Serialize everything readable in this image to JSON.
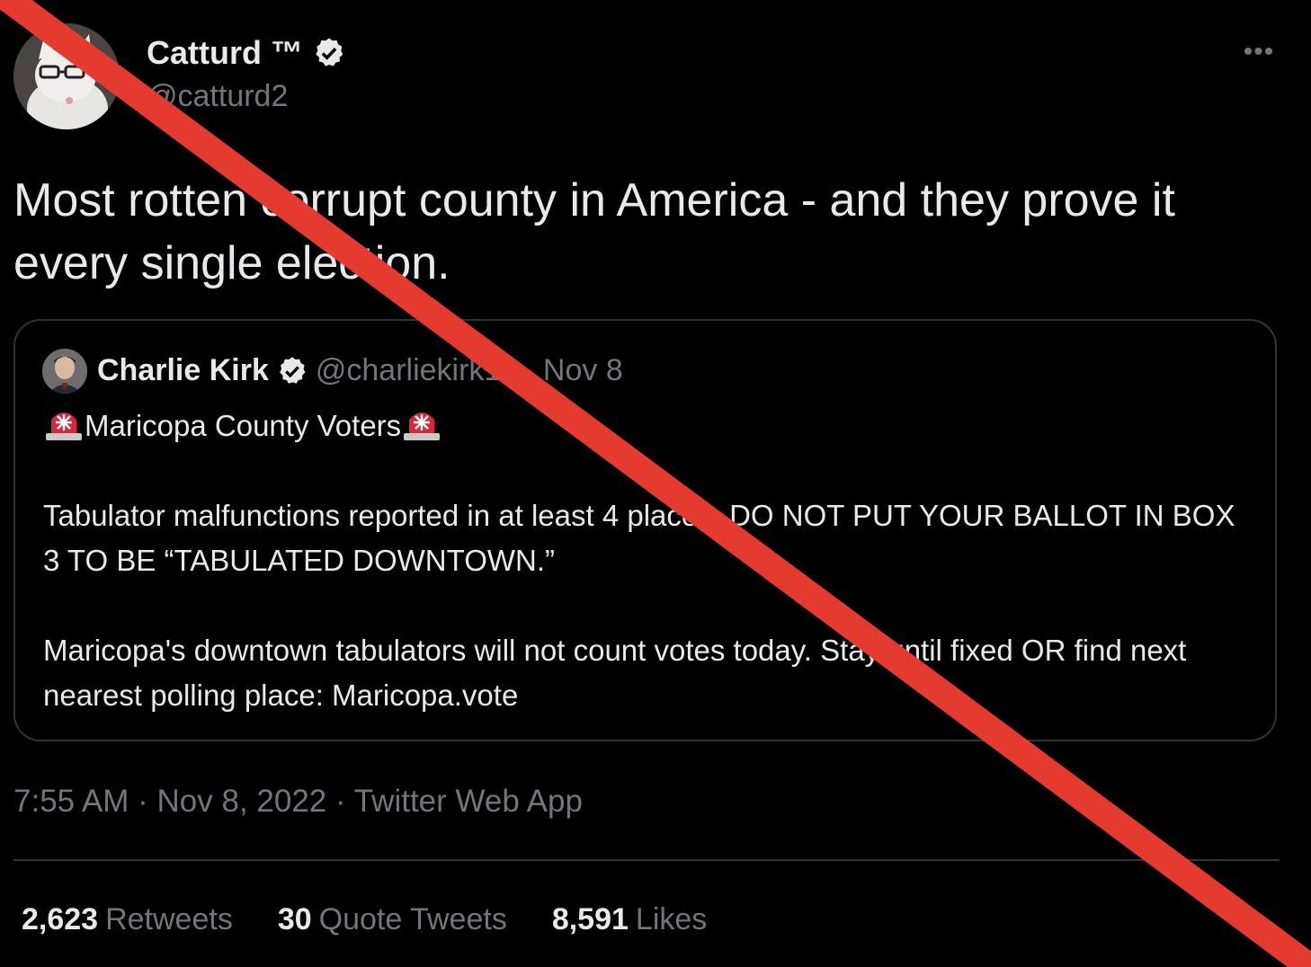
{
  "author": {
    "display_name": "Catturd ™",
    "handle": "@catturd2",
    "verified_icon": "verified-badge-icon"
  },
  "more_icon": "more-horizontal-icon",
  "tweet_text": "Most rotten corrupt county in America - and they prove it every single election.",
  "quoted_tweet": {
    "name": "Charlie Kirk",
    "handle_date": "@charliekirk11 · Nov 8",
    "heading": "Maricopa County Voters",
    "heading_icon": "police-siren-icon",
    "paragraph1": "Tabulator malfunctions reported in at least 4 places. DO NOT PUT YOUR BALLOT IN BOX 3 TO BE “TABULATED DOWNTOWN.”",
    "paragraph2": "Maricopa's downtown tabulators will not count votes today. Stay until fixed OR find next nearest polling place: Maricopa.vote"
  },
  "timestamp": "7:55 AM · Nov 8, 2022 · Twitter Web App",
  "stats": {
    "retweets_count": "2,623",
    "retweets_label": "Retweets",
    "quotes_count": "30",
    "quotes_label": "Quote Tweets",
    "likes_count": "8,591",
    "likes_label": "Likes"
  },
  "colors": {
    "background": "#000000",
    "primary_text": "#e7e9ea",
    "secondary_text": "#71767b",
    "border": "#2f3336",
    "overlay_cross": "#e53a2f"
  }
}
